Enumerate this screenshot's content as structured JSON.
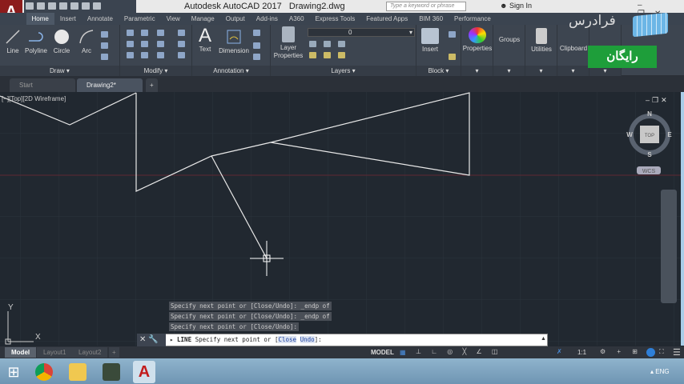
{
  "app": {
    "title": "Autodesk AutoCAD 2017",
    "document": "Drawing2.dwg",
    "logo_letter": "A"
  },
  "search": {
    "placeholder": "Type a keyword or phrase"
  },
  "account": {
    "sign_in": "Sign In"
  },
  "ribbon_tabs": [
    "Home",
    "Insert",
    "Annotate",
    "Parametric",
    "View",
    "Manage",
    "Output",
    "Add-ins",
    "A360",
    "Express Tools",
    "Featured Apps",
    "BIM 360",
    "Performance"
  ],
  "active_tab": "Home",
  "draw_panel": {
    "label": "Draw",
    "tools": [
      "Line",
      "Polyline",
      "Circle",
      "Arc"
    ]
  },
  "modify_panel": {
    "label": "Modify"
  },
  "annotation_panel": {
    "label": "Annotation",
    "tools": [
      "Text",
      "Dimension"
    ]
  },
  "layers_panel": {
    "label": "Layers",
    "tool": "Layer Properties",
    "current_layer": "0"
  },
  "block_panel": {
    "label": "Block",
    "tool": "Insert"
  },
  "other_panels": [
    "Properties",
    "Groups",
    "Utilities",
    "Clipboard"
  ],
  "watermark": {
    "brand": "فرادرس",
    "badge": "رایگان",
    "badge_color": "#1e9e3a"
  },
  "doc_tabs": [
    "Start",
    "Drawing2*"
  ],
  "viewport": {
    "label": "[−][Top][2D Wireframe]"
  },
  "viewcube": {
    "n": "N",
    "s": "S",
    "e": "E",
    "w": "W",
    "face": "TOP",
    "ucs": "WCS"
  },
  "ucs_icon": {
    "x": "X",
    "y": "Y"
  },
  "command_history": [
    "Specify next point or [Close/Undo]: _endp of",
    "Specify next point or [Close/Undo]: _endp of",
    "Specify next point or [Close/Undo]:"
  ],
  "command_line": {
    "command": "LINE",
    "prompt": "Specify next point or [",
    "opt1": "Close",
    "opt2": "Undo",
    "end": "]:"
  },
  "layout_tabs": [
    "Model",
    "Layout1",
    "Layout2"
  ],
  "status_bar": {
    "model": "MODEL",
    "scale": "1:1"
  },
  "taskbar": {
    "lang": "ENG"
  },
  "colors": {
    "canvas": "#212830",
    "ribbon": "#3d4550",
    "x_axis": "#6b2a35"
  }
}
